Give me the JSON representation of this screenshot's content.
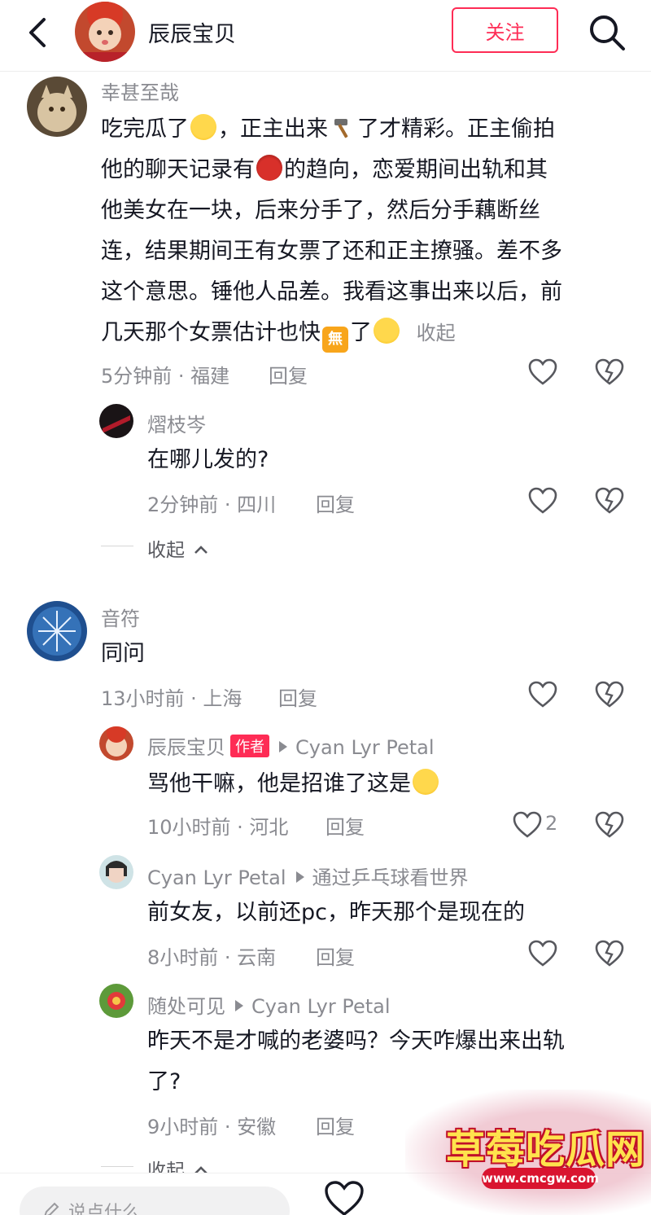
{
  "header": {
    "username": "辰辰宝贝",
    "follow_label": "关注"
  },
  "comments": [
    {
      "user": "幸甚至哉",
      "lines": [
        [
          "吃完瓜了",
          "[laugh]",
          "，正主出来",
          "[hammer]",
          "了才精彩。正主偷拍"
        ],
        [
          "他的聊天记录有",
          "[bug]",
          "的趋向，恋爱期间出轨和其"
        ],
        [
          "他美女在一块，后来分手了，然后分手藕断丝"
        ],
        [
          "连，结果期间王有女票了还和正主撩骚。差不多"
        ],
        [
          "这个意思。锤他人品差。我看这事出来以后，前"
        ],
        [
          "几天那个女票估计也快",
          "[wu]",
          "了",
          "[cry]"
        ]
      ],
      "collapse_inline": "收起",
      "meta": "5分钟前 · 福建",
      "reply": "回复",
      "emoji_wu_text": "無"
    },
    {
      "user": "熠枝岑",
      "text": "在哪儿发的?",
      "meta": "2分钟前 · 四川",
      "reply": "回复"
    },
    {
      "user": "音符",
      "text": "同问",
      "meta": "13小时前 · 上海",
      "reply": "回复"
    },
    {
      "user": "辰辰宝贝",
      "author_tag": "作者",
      "reply_to": "Cyan Lyr Petal",
      "text": "骂他干嘛，他是招谁了这是",
      "meta": "10小时前 · 河北",
      "reply": "回复",
      "likes": "2"
    },
    {
      "user": "Cyan Lyr Petal",
      "reply_to": "通过乒乓球看世界",
      "text": "前女友，以前还pc，昨天那个是现在的",
      "meta": "8小时前 · 云南",
      "reply": "回复"
    },
    {
      "user": "随处可见",
      "reply_to": "Cyan Lyr Petal",
      "text_line1": "昨天不是才喊的老婆吗？今天咋爆出来出轨",
      "text_line2": "了?",
      "meta": "9小时前 · 安徽",
      "reply": "回复"
    }
  ],
  "collapse_label": "收起",
  "bottom": {
    "placeholder": "说点什么..."
  },
  "watermark": {
    "title": "草莓吃瓜网",
    "url": "www.cmcgw.com"
  },
  "colors": {
    "accent": "#fe2c55",
    "secondary_text": "#8a8b91",
    "primary_text": "#161823"
  },
  "icons": [
    "back-arrow-icon",
    "search-icon",
    "heart-icon",
    "dislike-heart-icon",
    "pencil-icon",
    "chevron-up-icon"
  ]
}
